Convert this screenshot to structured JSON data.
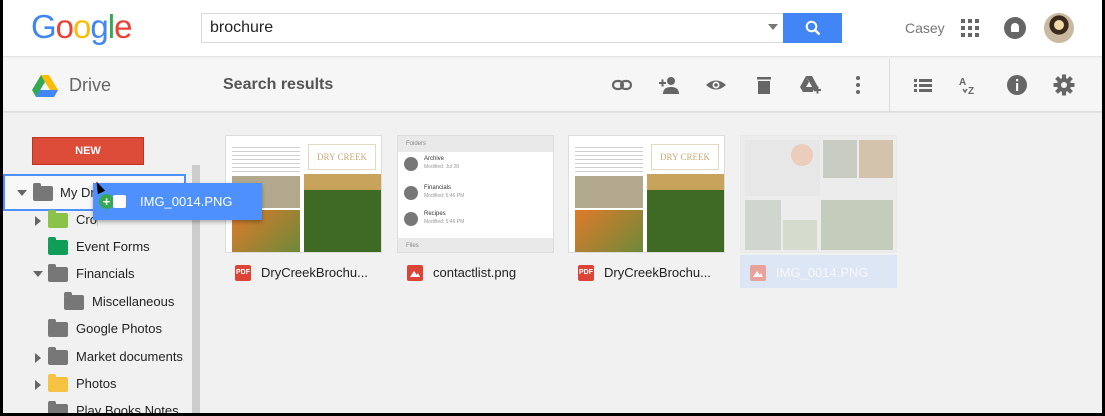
{
  "header": {
    "logo": "Google",
    "search": {
      "value": "brochure"
    },
    "user_name": "Casey"
  },
  "toolbar": {
    "app_name": "Drive",
    "page_title": "Search results",
    "icons": [
      "link-icon",
      "share-icon",
      "preview-icon",
      "delete-icon",
      "add-to-drive-icon",
      "more-icon",
      "list-view-icon",
      "sort-icon",
      "info-icon",
      "settings-icon"
    ]
  },
  "sidebar": {
    "new_label": "NEW",
    "items": [
      {
        "label": "My Drive"
      },
      {
        "label": "Crop"
      },
      {
        "label": "Event Forms"
      },
      {
        "label": "Financials"
      },
      {
        "label": "Miscellaneous"
      },
      {
        "label": "Google Photos"
      },
      {
        "label": "Market documents"
      },
      {
        "label": "Photos"
      },
      {
        "label": "Play Books Notes"
      }
    ]
  },
  "thumb_text": {
    "dry_creek": "DRY CREEK",
    "folders": "Folders",
    "files": "Files",
    "list": [
      {
        "name": "Archive",
        "meta": "Modified: Jul 28"
      },
      {
        "name": "Financials",
        "meta": "Modified: 5:46 PM"
      },
      {
        "name": "Recipes",
        "meta": "Modified: 5:46 PM"
      }
    ]
  },
  "files": [
    {
      "name": "DryCreekBrochu...",
      "type": "PDF"
    },
    {
      "name": "contactlist.png",
      "type": "image"
    },
    {
      "name": "DryCreekBrochu...",
      "type": "PDF"
    },
    {
      "name": "IMG_0014.PNG",
      "type": "image"
    }
  ],
  "drag": {
    "label": "IMG_0014.PNG"
  },
  "colors": {
    "blue": "#4285f4",
    "red": "#dd4b39",
    "green": "#34a853",
    "pdf_red": "#db4437"
  }
}
